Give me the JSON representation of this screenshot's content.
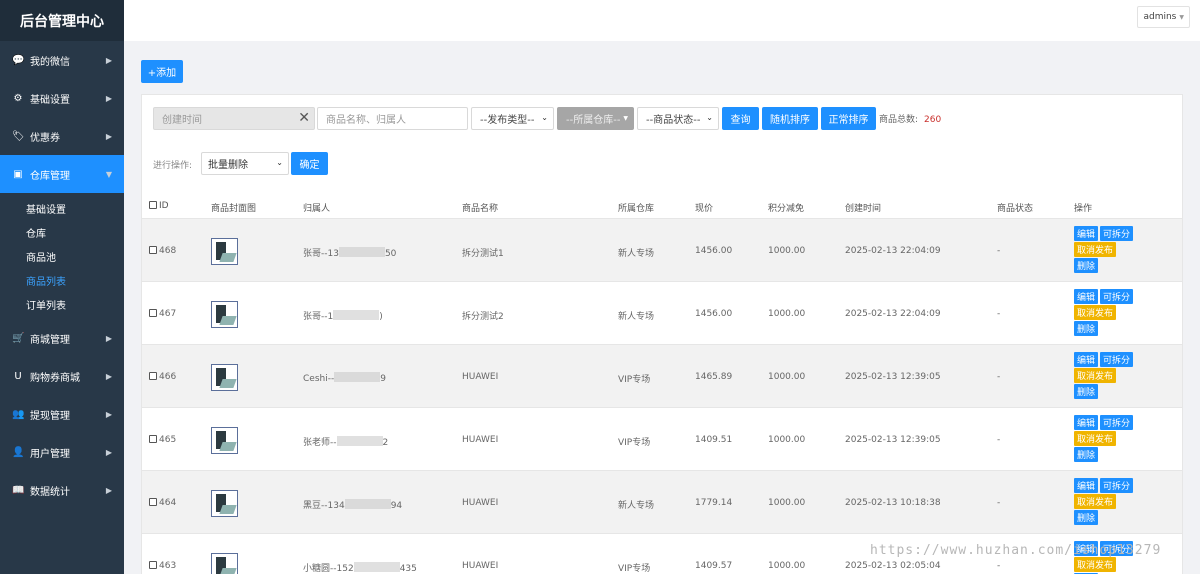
{
  "brand": "后台管理中心",
  "user": "admins",
  "menu": [
    {
      "label": "我的微信",
      "icon": "💬"
    },
    {
      "label": "基础设置",
      "icon": "⚙"
    },
    {
      "label": "优惠券",
      "icon": "🏷"
    },
    {
      "label": "仓库管理",
      "icon": "▣"
    }
  ],
  "submenu": [
    "基础设置",
    "仓库",
    "商品池",
    "商品列表",
    "订单列表"
  ],
  "menu_after": [
    {
      "label": "商城管理",
      "icon": "🛒"
    },
    {
      "label": "购物券商城",
      "icon": "U"
    },
    {
      "label": "提现管理",
      "icon": "👥"
    },
    {
      "label": "用户管理",
      "icon": "👤"
    },
    {
      "label": "数据统计",
      "icon": "📖"
    }
  ],
  "toolbar": {
    "add": "+添加",
    "date_placeholder": "创建时间",
    "name_placeholder": "商品名称、归属人",
    "type_select": "--发布类型--",
    "warehouse_select": "--所属仓库--",
    "status_select": "--商品状态--",
    "query": "查询",
    "random_sort": "随机排序",
    "normal_sort": "正常排序",
    "total_label": "商品总数:",
    "total_count": "260",
    "batch_label": "进行操作:",
    "batch_select": "批量删除",
    "confirm": "确定"
  },
  "table": {
    "headers": [
      "ID",
      "商品封面图",
      "归属人",
      "商品名称",
      "所属仓库",
      "现价",
      "积分减免",
      "创建时间",
      "商品状态",
      "操作"
    ],
    "actions": {
      "edit": "编辑",
      "split": "可拆分",
      "unpublish": "取消发布",
      "delete": "删除"
    },
    "rows": [
      {
        "id": "468",
        "owner_a": "张哥--13",
        "owner_b": "50",
        "name": "拆分测试1",
        "warehouse": "新人专场",
        "price": "1456.00",
        "points": "1000.00",
        "created": "2025-02-13 22:04:09",
        "status": "-"
      },
      {
        "id": "467",
        "owner_a": "张哥--1",
        "owner_b": ")",
        "name": "拆分测试2",
        "warehouse": "新人专场",
        "price": "1456.00",
        "points": "1000.00",
        "created": "2025-02-13 22:04:09",
        "status": "-"
      },
      {
        "id": "466",
        "owner_a": "Ceshi--",
        "owner_b": "9",
        "name": "HUAWEI",
        "warehouse": "VIP专场",
        "price": "1465.89",
        "points": "1000.00",
        "created": "2025-02-13 12:39:05",
        "status": "-"
      },
      {
        "id": "465",
        "owner_a": "张老师--",
        "owner_b": "2",
        "name": "HUAWEI",
        "warehouse": "VIP专场",
        "price": "1409.51",
        "points": "1000.00",
        "created": "2025-02-13 12:39:05",
        "status": "-"
      },
      {
        "id": "464",
        "owner_a": "黑豆--134",
        "owner_b": "94",
        "name": "HUAWEI",
        "warehouse": "新人专场",
        "price": "1779.14",
        "points": "1000.00",
        "created": "2025-02-13 10:18:38",
        "status": "-"
      },
      {
        "id": "463",
        "owner_a": "小糖圆--152",
        "owner_b": "435",
        "name": "HUAWEI",
        "warehouse": "VIP专场",
        "price": "1409.57",
        "points": "1000.00",
        "created": "2025-02-13 02:05:04",
        "status": "-"
      }
    ]
  },
  "watermark": "https://www.huzhan.com/ishop13279"
}
